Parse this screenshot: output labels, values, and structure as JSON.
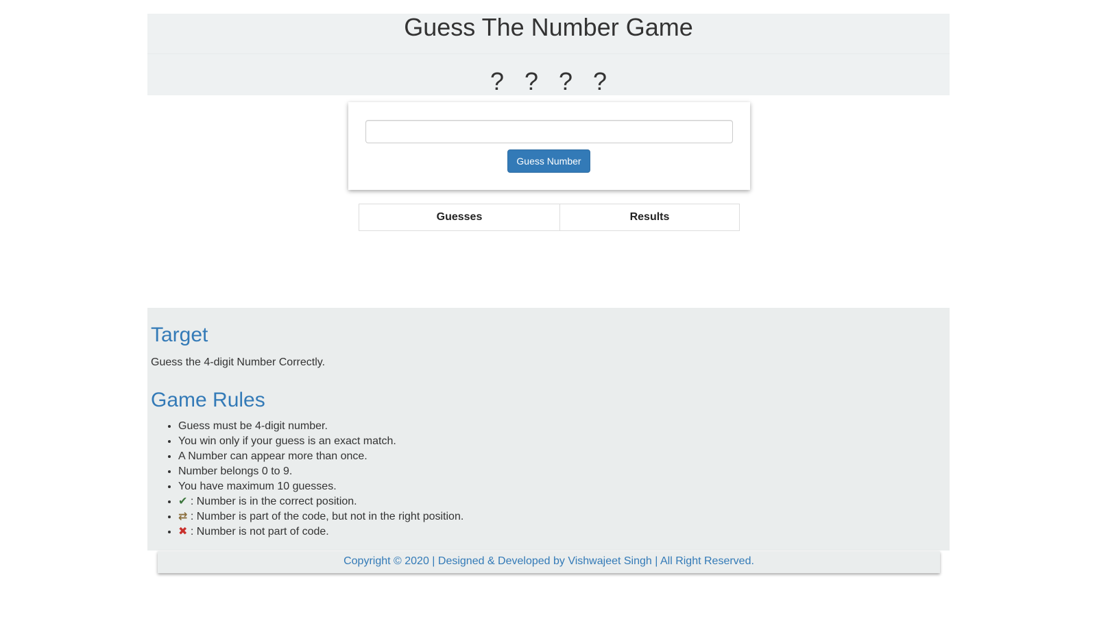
{
  "header": {
    "title": "Guess The Number Game",
    "hidden_number": "? ? ? ?"
  },
  "guess_form": {
    "input_value": "",
    "input_placeholder": "",
    "button_label": "Guess Number"
  },
  "results_table": {
    "columns": [
      "Guesses",
      "Results"
    ]
  },
  "info": {
    "target_heading": "Target",
    "target_text": "Guess the 4-digit Number Correctly.",
    "rules_heading": "Game Rules",
    "rules": [
      "Guess must be 4-digit number.",
      "You win only if your guess is an exact match.",
      "A Number can appear more than once.",
      "Number belongs 0 to 9.",
      "You have maximum 10 guesses."
    ],
    "legend": [
      {
        "icon": "check-icon",
        "symbol": "✔",
        "text": " : Number is in the correct position."
      },
      {
        "icon": "swap-icon",
        "symbol": "⇄",
        "text": " : Number is part of the code, but not in the right position."
      },
      {
        "icon": "cross-icon",
        "symbol": "✖",
        "text": " : Number is not part of code."
      }
    ]
  },
  "footer": {
    "text": "Copyright © 2020 | Designed & Developed by Vishwajeet Singh | All Right Reserved."
  },
  "colors": {
    "accent": "#337ab7",
    "check": "#3c763d",
    "swap": "#8a6d3b",
    "cross": "#c9302c"
  }
}
